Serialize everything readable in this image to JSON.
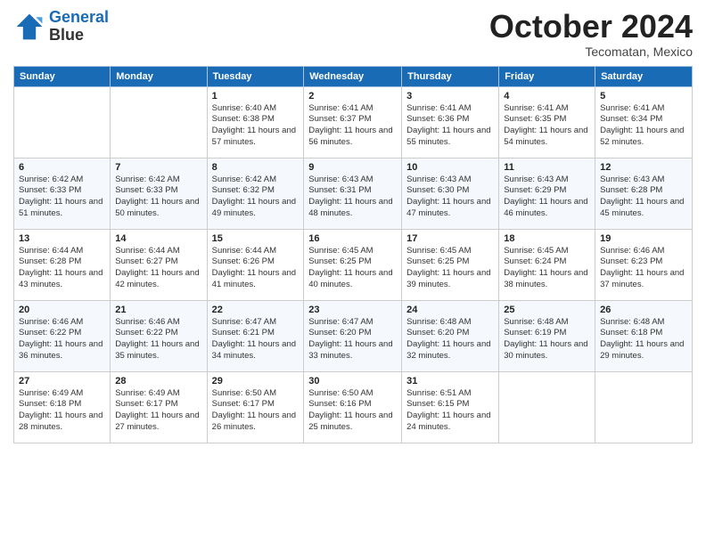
{
  "header": {
    "logo_line1": "General",
    "logo_line2": "Blue",
    "month": "October 2024",
    "location": "Tecomatan, Mexico"
  },
  "days_of_week": [
    "Sunday",
    "Monday",
    "Tuesday",
    "Wednesday",
    "Thursday",
    "Friday",
    "Saturday"
  ],
  "weeks": [
    [
      {
        "day": "",
        "info": ""
      },
      {
        "day": "",
        "info": ""
      },
      {
        "day": "1",
        "info": "Sunrise: 6:40 AM\nSunset: 6:38 PM\nDaylight: 11 hours and 57 minutes."
      },
      {
        "day": "2",
        "info": "Sunrise: 6:41 AM\nSunset: 6:37 PM\nDaylight: 11 hours and 56 minutes."
      },
      {
        "day": "3",
        "info": "Sunrise: 6:41 AM\nSunset: 6:36 PM\nDaylight: 11 hours and 55 minutes."
      },
      {
        "day": "4",
        "info": "Sunrise: 6:41 AM\nSunset: 6:35 PM\nDaylight: 11 hours and 54 minutes."
      },
      {
        "day": "5",
        "info": "Sunrise: 6:41 AM\nSunset: 6:34 PM\nDaylight: 11 hours and 52 minutes."
      }
    ],
    [
      {
        "day": "6",
        "info": "Sunrise: 6:42 AM\nSunset: 6:33 PM\nDaylight: 11 hours and 51 minutes."
      },
      {
        "day": "7",
        "info": "Sunrise: 6:42 AM\nSunset: 6:33 PM\nDaylight: 11 hours and 50 minutes."
      },
      {
        "day": "8",
        "info": "Sunrise: 6:42 AM\nSunset: 6:32 PM\nDaylight: 11 hours and 49 minutes."
      },
      {
        "day": "9",
        "info": "Sunrise: 6:43 AM\nSunset: 6:31 PM\nDaylight: 11 hours and 48 minutes."
      },
      {
        "day": "10",
        "info": "Sunrise: 6:43 AM\nSunset: 6:30 PM\nDaylight: 11 hours and 47 minutes."
      },
      {
        "day": "11",
        "info": "Sunrise: 6:43 AM\nSunset: 6:29 PM\nDaylight: 11 hours and 46 minutes."
      },
      {
        "day": "12",
        "info": "Sunrise: 6:43 AM\nSunset: 6:28 PM\nDaylight: 11 hours and 45 minutes."
      }
    ],
    [
      {
        "day": "13",
        "info": "Sunrise: 6:44 AM\nSunset: 6:28 PM\nDaylight: 11 hours and 43 minutes."
      },
      {
        "day": "14",
        "info": "Sunrise: 6:44 AM\nSunset: 6:27 PM\nDaylight: 11 hours and 42 minutes."
      },
      {
        "day": "15",
        "info": "Sunrise: 6:44 AM\nSunset: 6:26 PM\nDaylight: 11 hours and 41 minutes."
      },
      {
        "day": "16",
        "info": "Sunrise: 6:45 AM\nSunset: 6:25 PM\nDaylight: 11 hours and 40 minutes."
      },
      {
        "day": "17",
        "info": "Sunrise: 6:45 AM\nSunset: 6:25 PM\nDaylight: 11 hours and 39 minutes."
      },
      {
        "day": "18",
        "info": "Sunrise: 6:45 AM\nSunset: 6:24 PM\nDaylight: 11 hours and 38 minutes."
      },
      {
        "day": "19",
        "info": "Sunrise: 6:46 AM\nSunset: 6:23 PM\nDaylight: 11 hours and 37 minutes."
      }
    ],
    [
      {
        "day": "20",
        "info": "Sunrise: 6:46 AM\nSunset: 6:22 PM\nDaylight: 11 hours and 36 minutes."
      },
      {
        "day": "21",
        "info": "Sunrise: 6:46 AM\nSunset: 6:22 PM\nDaylight: 11 hours and 35 minutes."
      },
      {
        "day": "22",
        "info": "Sunrise: 6:47 AM\nSunset: 6:21 PM\nDaylight: 11 hours and 34 minutes."
      },
      {
        "day": "23",
        "info": "Sunrise: 6:47 AM\nSunset: 6:20 PM\nDaylight: 11 hours and 33 minutes."
      },
      {
        "day": "24",
        "info": "Sunrise: 6:48 AM\nSunset: 6:20 PM\nDaylight: 11 hours and 32 minutes."
      },
      {
        "day": "25",
        "info": "Sunrise: 6:48 AM\nSunset: 6:19 PM\nDaylight: 11 hours and 30 minutes."
      },
      {
        "day": "26",
        "info": "Sunrise: 6:48 AM\nSunset: 6:18 PM\nDaylight: 11 hours and 29 minutes."
      }
    ],
    [
      {
        "day": "27",
        "info": "Sunrise: 6:49 AM\nSunset: 6:18 PM\nDaylight: 11 hours and 28 minutes."
      },
      {
        "day": "28",
        "info": "Sunrise: 6:49 AM\nSunset: 6:17 PM\nDaylight: 11 hours and 27 minutes."
      },
      {
        "day": "29",
        "info": "Sunrise: 6:50 AM\nSunset: 6:17 PM\nDaylight: 11 hours and 26 minutes."
      },
      {
        "day": "30",
        "info": "Sunrise: 6:50 AM\nSunset: 6:16 PM\nDaylight: 11 hours and 25 minutes."
      },
      {
        "day": "31",
        "info": "Sunrise: 6:51 AM\nSunset: 6:15 PM\nDaylight: 11 hours and 24 minutes."
      },
      {
        "day": "",
        "info": ""
      },
      {
        "day": "",
        "info": ""
      }
    ]
  ]
}
